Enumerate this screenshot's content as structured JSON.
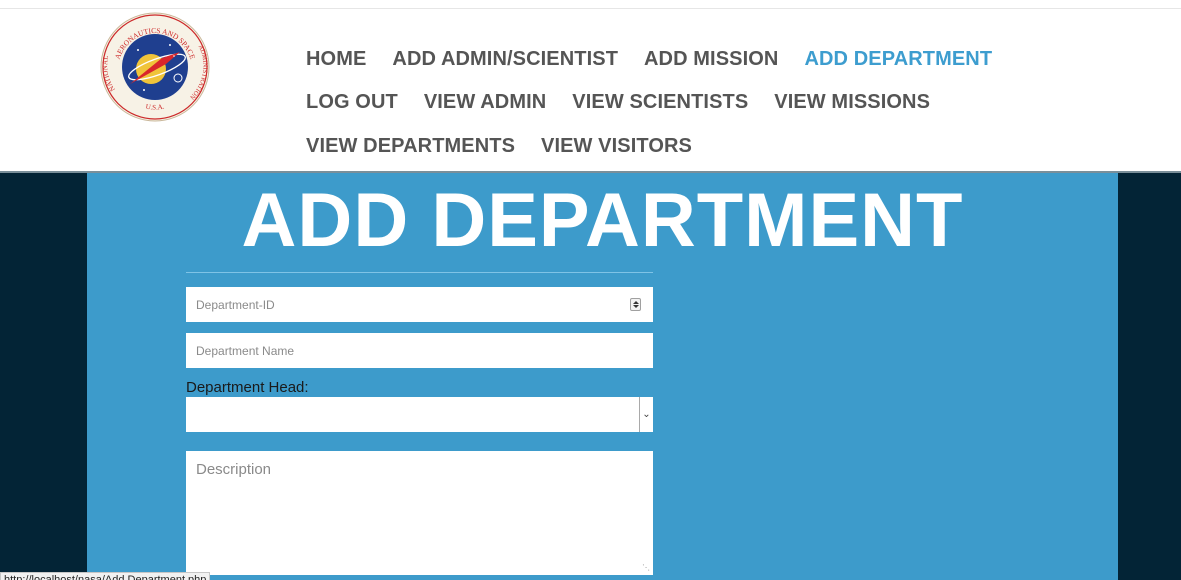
{
  "logo": {
    "top_text": "AERONAUTICS AND SPACE",
    "left_text": "NATIONAL",
    "right_text": "ADMINISTRATION",
    "bottom_text": "U.S.A.",
    "icon": "nasa-meatball-seal"
  },
  "nav": {
    "items": [
      {
        "label": "HOME"
      },
      {
        "label": "ADD ADMIN/SCIENTIST"
      },
      {
        "label": "ADD MISSION"
      },
      {
        "label": "ADD DEPARTMENT"
      },
      {
        "label": "LOG OUT"
      },
      {
        "label": "VIEW ADMIN"
      },
      {
        "label": "VIEW SCIENTISTS"
      },
      {
        "label": "VIEW MISSIONS"
      },
      {
        "label": "VIEW DEPARTMENTS"
      },
      {
        "label": "VIEW VISITORS"
      }
    ],
    "active_item": "ADD DEPARTMENT"
  },
  "main": {
    "title": "ADD DEPARTMENT"
  },
  "form": {
    "department_id": {
      "placeholder": "Department-ID",
      "value": ""
    },
    "department_name": {
      "placeholder": "Department Name",
      "value": ""
    },
    "department_head": {
      "label": "Department Head:",
      "selected": ""
    },
    "description": {
      "placeholder": "Description",
      "value": ""
    }
  },
  "status_bar": {
    "url": "http://localhost/nasa/Add Department.php"
  },
  "colors": {
    "nav_text": "#555555",
    "nav_active": "#3d9dcf",
    "band": "#3d9bcb",
    "side_panels": "#032436"
  }
}
